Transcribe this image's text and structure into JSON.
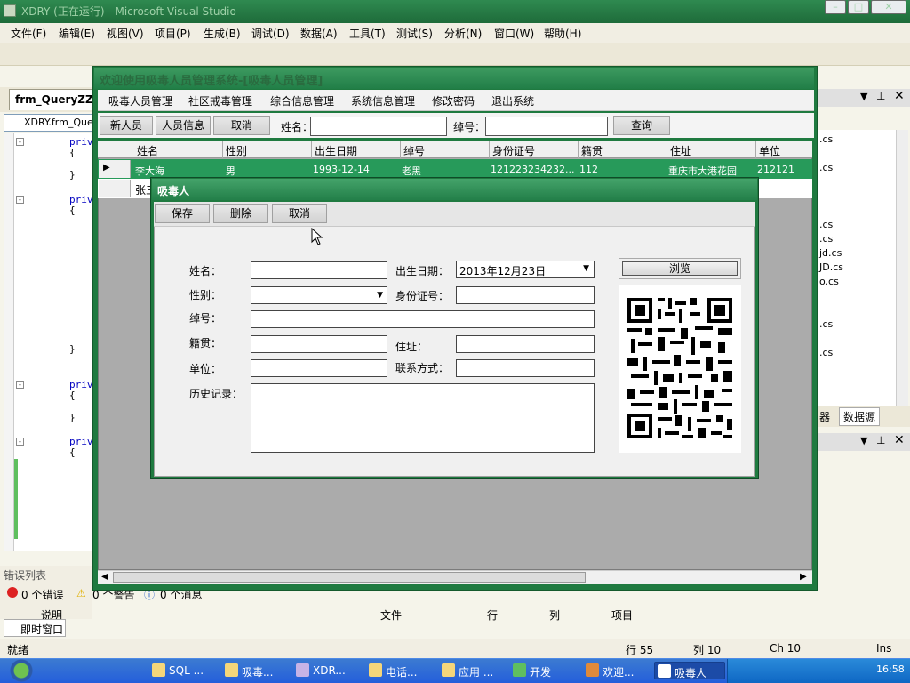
{
  "vs": {
    "title": "XDRY (正在运行) - Microsoft Visual Studio",
    "menu": [
      "文件(F)",
      "编辑(E)",
      "视图(V)",
      "项目(P)",
      "生成(B)",
      "调试(D)",
      "数据(A)",
      "工具(T)",
      "测试(S)",
      "分析(N)",
      "窗口(W)",
      "帮助(H)"
    ],
    "editor_tab": "frm_QueryZZJD",
    "editor_combo": "XDRY.frm_Query",
    "code_lines": [
      "priv",
      "{",
      "}",
      "priv",
      "{",
      "}",
      "priv",
      "{",
      "}",
      "priv",
      "{"
    ],
    "error_list": {
      "title": "错误列表",
      "errors": "0 个错误",
      "warnings": "0 个警告",
      "messages": "0 个消息"
    },
    "bottom_cols": [
      "说明",
      "文件",
      "行",
      "列",
      "项目"
    ],
    "immediate": "即时窗口",
    "status": {
      "ready": "就绪",
      "line": "行 55",
      "col": "列 10",
      "ch": "Ch 10",
      "ins": "Ins"
    }
  },
  "right_pane": {
    "files": [
      ".cs",
      ".cs",
      ".cs",
      ".cs",
      "jd.cs",
      "JD.cs",
      "o.cs",
      ".cs",
      ".cs"
    ],
    "tabs": [
      "器",
      "数据源"
    ]
  },
  "app": {
    "title": "欢迎使用吸毒人员管理系统-[吸毒人员管理]",
    "menu": [
      "吸毒人员管理",
      "社区戒毒管理",
      "综合信息管理",
      "系统信息管理",
      "修改密码",
      "退出系统"
    ],
    "toolbar": {
      "new": "新人员",
      "info": "人员信息",
      "cancel": "取消",
      "name_label": "姓名：",
      "no_label": "绰号：",
      "query": "查询"
    },
    "grid": {
      "columns": [
        "姓名",
        "性别",
        "出生日期",
        "绰号",
        "身份证号",
        "籍贯",
        "住址",
        "单位"
      ],
      "rows": [
        [
          "李大海",
          "男",
          "1993-12-14",
          "老黑",
          "121223234232...",
          "112",
          "重庆市大港花园",
          "212121"
        ],
        [
          "张三",
          "",
          "",
          "",
          "",
          "",
          "",
          ""
        ]
      ]
    }
  },
  "dialog": {
    "title": "吸毒人",
    "buttons": {
      "save": "保存",
      "delete": "删除",
      "cancel": "取消"
    },
    "labels": {
      "name": "姓名：",
      "gender": "性别：",
      "alias": "绰号：",
      "native": "籍贯：",
      "unit": "单位：",
      "history": "历史记录：",
      "birth": "出生日期：",
      "id": "身份证号：",
      "address": "住址：",
      "contact": "联系方式："
    },
    "birth_value": "2013年12月23日",
    "browse": "浏览"
  },
  "taskbar": {
    "items": [
      "SQL ...",
      "吸毒...",
      "XDR...",
      "电话...",
      "应用 ...",
      "开发",
      "欢迎...",
      "吸毒人"
    ],
    "clock": "16:58"
  }
}
